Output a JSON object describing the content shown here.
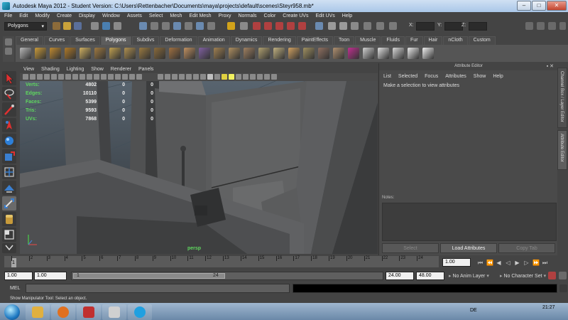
{
  "window": {
    "title": "Autodesk Maya 2012 - Student Version: C:\\Users\\Rettenbacher\\Documents\\maya\\projects\\default\\scenes\\Steyr958.mb*"
  },
  "menubar": [
    "File",
    "Edit",
    "Modify",
    "Create",
    "Display",
    "Window",
    "Assets",
    "Select",
    "Mesh",
    "Edit Mesh",
    "Proxy",
    "Normals",
    "Color",
    "Create UVs",
    "Edit UVs",
    "Help"
  ],
  "status_line": {
    "mode": "Polygons",
    "coord_labels": [
      "X:",
      "Y:",
      "Z:"
    ]
  },
  "shelf": {
    "tabs": [
      "General",
      "Curves",
      "Surfaces",
      "Polygons",
      "Subdivs",
      "Deformation",
      "Animation",
      "Dynamics",
      "Rendering",
      "PaintEffects",
      "Toon",
      "Muscle",
      "Fluids",
      "Fur",
      "Hair",
      "nCloth",
      "Custom"
    ],
    "active_tab": "Polygons"
  },
  "viewport": {
    "menu": [
      "View",
      "Shading",
      "Lighting",
      "Show",
      "Renderer",
      "Panels"
    ],
    "camera": "persp",
    "hud": [
      {
        "label": "Verts:",
        "a": "4802",
        "b": "0",
        "c": "0"
      },
      {
        "label": "Edges:",
        "a": "10110",
        "b": "0",
        "c": "0"
      },
      {
        "label": "Faces:",
        "a": "5399",
        "b": "0",
        "c": "0"
      },
      {
        "label": "Tris:",
        "a": "9593",
        "b": "0",
        "c": "0"
      },
      {
        "label": "UVs:",
        "a": "7868",
        "b": "0",
        "c": "0"
      }
    ]
  },
  "attribute_editor": {
    "title": "Attribute Editor",
    "menu": [
      "List",
      "Selected",
      "Focus",
      "Attributes",
      "Show",
      "Help"
    ],
    "message": "Make a selection to view attributes",
    "notes_label": "Notes:",
    "buttons": {
      "select": "Select",
      "load": "Load Attributes",
      "copy": "Copy Tab"
    }
  },
  "side_tabs": {
    "channel_box": "Channel Box / Layer Editor",
    "attribute_editor": "Attribute Editor"
  },
  "time_slider": {
    "ticks": [
      "1",
      "2",
      "3",
      "4",
      "5",
      "6",
      "7",
      "8",
      "9",
      "10",
      "11",
      "12",
      "13",
      "14",
      "15",
      "16",
      "17",
      "18",
      "19",
      "20",
      "21",
      "22",
      "23",
      "24"
    ],
    "current_frame": "1",
    "current_frame_field": "1.00"
  },
  "range_slider": {
    "start": "1.00",
    "anim_start": "1.00",
    "knob_start": "1",
    "knob_end": "24",
    "anim_end": "24.00",
    "end": "48.00",
    "anim_layer": "No Anim Layer",
    "character_set": "No Character Set"
  },
  "command_line": {
    "label": "MEL"
  },
  "help_line": {
    "text": "Show Manipulator Tool: Select an object."
  },
  "taskbar": {
    "clock": "21:27",
    "language": "DE"
  },
  "colors": {
    "hud_text": "#5fd75f",
    "viewport_top": "#58646f",
    "viewport_bottom": "#2e3236",
    "panel": "#4a4a4a"
  }
}
